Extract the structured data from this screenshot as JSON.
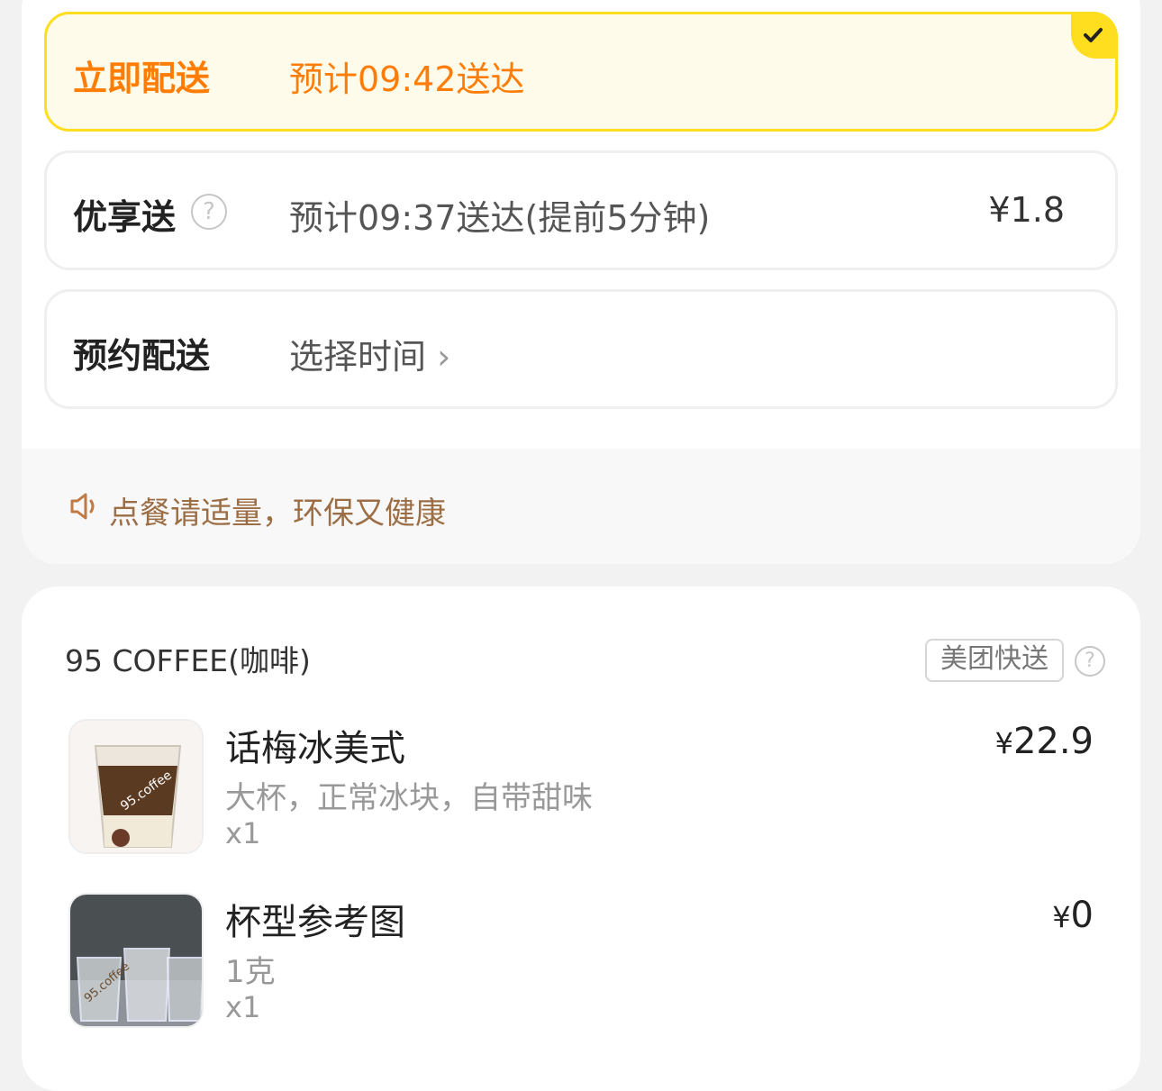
{
  "delivery": {
    "options": [
      {
        "title": "立即配送",
        "desc": "预计09:42送达",
        "price": "",
        "selected": true
      },
      {
        "title": "优享送",
        "desc": "预计09:37送达(提前5分钟)",
        "price": "¥1.8",
        "selected": false
      },
      {
        "title": "预约配送",
        "desc": "选择时间",
        "price": "",
        "selected": false
      }
    ],
    "help_icon": "question-circle-icon",
    "chevron": "›"
  },
  "notice": {
    "text": "点餐请适量，环保又健康",
    "icon": "speaker-icon"
  },
  "order": {
    "shop_name": "95 COFFEE(咖啡)",
    "delivery_tag": "美团快送",
    "items": [
      {
        "name": "话梅冰美式",
        "spec": "大杯，正常冰块，自带甜味",
        "qty": "x1",
        "currency": "¥",
        "price": "22.9",
        "image_label": "95.coffee"
      },
      {
        "name": "杯型参考图",
        "spec": "1克",
        "qty": "x1",
        "currency": "¥",
        "price": "0",
        "image_label": "95.coffee"
      }
    ]
  },
  "colors": {
    "accent_yellow": "#ffdd1f",
    "accent_orange": "#ff7c05",
    "notice_brown": "#9c6e46"
  }
}
